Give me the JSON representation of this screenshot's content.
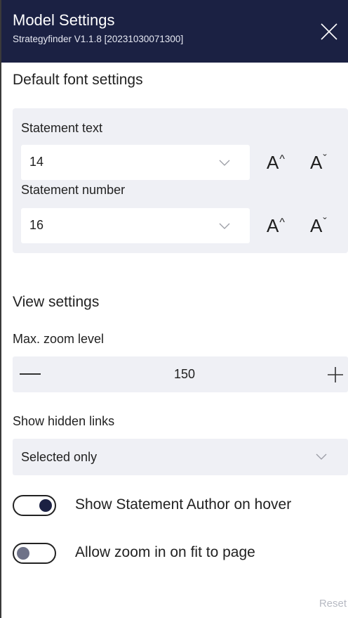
{
  "header": {
    "title": "Model Settings",
    "subtitle": "Strategyfinder V1.1.8 [20231030071300]",
    "close_icon": "close-icon"
  },
  "font_settings": {
    "title": "Default font settings",
    "statement_text": {
      "label": "Statement text",
      "value": "14"
    },
    "statement_number": {
      "label": "Statement number",
      "value": "16"
    },
    "increase_glyph": "A",
    "increase_mark": "^",
    "decrease_glyph": "A",
    "decrease_mark": "ˇ"
  },
  "view_settings": {
    "title": "View settings",
    "zoom_label": "Max. zoom level",
    "zoom_value": "150",
    "hidden_links_label": "Show hidden links",
    "hidden_links_value": "Selected only"
  },
  "toggles": [
    {
      "label": "Show Statement Author on hover",
      "on": true
    },
    {
      "label": "Allow zoom in on fit to page",
      "on": false
    }
  ],
  "reset_label": "Reset",
  "colors": {
    "header_bg": "#1b2143",
    "panel_bg": "#eff0f5",
    "toggle_on_knob": "#1b2143",
    "toggle_off_knob": "#6e7288"
  }
}
